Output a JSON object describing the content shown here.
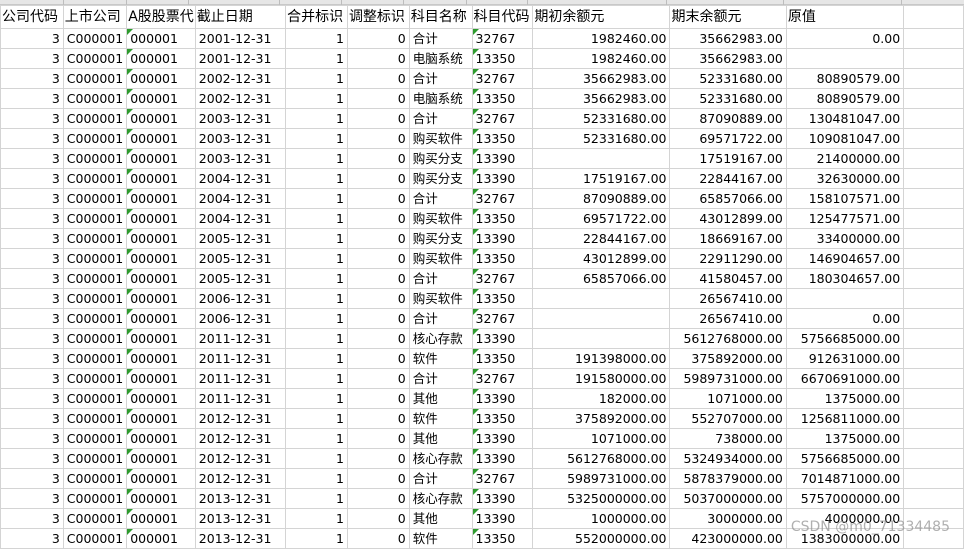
{
  "columns": [
    "公司代码",
    "上市公司",
    "A股股票代码",
    "截止日期",
    "合并标识",
    "调整标识",
    "科目名称",
    "科目代码",
    "期初余额元",
    "期末余额元",
    "原值"
  ],
  "header_visible": [
    "公司代码",
    "上市公司",
    "A股股票代",
    "截止日期",
    "合并标识",
    "调整标识",
    "科目名称",
    "科目代码",
    "期初余额元",
    "期末余额元",
    "原值"
  ],
  "rows": [
    [
      "3",
      "C000001",
      "000001",
      "2001-12-31",
      "1",
      "0",
      "合计",
      "32767",
      "1982460.00",
      "35662983.00",
      "0.00"
    ],
    [
      "3",
      "C000001",
      "000001",
      "2001-12-31",
      "1",
      "0",
      "电脑系统",
      "13350",
      "1982460.00",
      "35662983.00",
      ""
    ],
    [
      "3",
      "C000001",
      "000001",
      "2002-12-31",
      "1",
      "0",
      "合计",
      "32767",
      "35662983.00",
      "52331680.00",
      "80890579.00"
    ],
    [
      "3",
      "C000001",
      "000001",
      "2002-12-31",
      "1",
      "0",
      "电脑系统",
      "13350",
      "35662983.00",
      "52331680.00",
      "80890579.00"
    ],
    [
      "3",
      "C000001",
      "000001",
      "2003-12-31",
      "1",
      "0",
      "合计",
      "32767",
      "52331680.00",
      "87090889.00",
      "130481047.00"
    ],
    [
      "3",
      "C000001",
      "000001",
      "2003-12-31",
      "1",
      "0",
      "购买软件",
      "13350",
      "52331680.00",
      "69571722.00",
      "109081047.00"
    ],
    [
      "3",
      "C000001",
      "000001",
      "2003-12-31",
      "1",
      "0",
      "购买分支",
      "13390",
      "",
      "17519167.00",
      "21400000.00"
    ],
    [
      "3",
      "C000001",
      "000001",
      "2004-12-31",
      "1",
      "0",
      "购买分支",
      "13390",
      "17519167.00",
      "22844167.00",
      "32630000.00"
    ],
    [
      "3",
      "C000001",
      "000001",
      "2004-12-31",
      "1",
      "0",
      "合计",
      "32767",
      "87090889.00",
      "65857066.00",
      "158107571.00"
    ],
    [
      "3",
      "C000001",
      "000001",
      "2004-12-31",
      "1",
      "0",
      "购买软件",
      "13350",
      "69571722.00",
      "43012899.00",
      "125477571.00"
    ],
    [
      "3",
      "C000001",
      "000001",
      "2005-12-31",
      "1",
      "0",
      "购买分支",
      "13390",
      "22844167.00",
      "18669167.00",
      "33400000.00"
    ],
    [
      "3",
      "C000001",
      "000001",
      "2005-12-31",
      "1",
      "0",
      "购买软件",
      "13350",
      "43012899.00",
      "22911290.00",
      "146904657.00"
    ],
    [
      "3",
      "C000001",
      "000001",
      "2005-12-31",
      "1",
      "0",
      "合计",
      "32767",
      "65857066.00",
      "41580457.00",
      "180304657.00"
    ],
    [
      "3",
      "C000001",
      "000001",
      "2006-12-31",
      "1",
      "0",
      "购买软件",
      "13350",
      "",
      "26567410.00",
      ""
    ],
    [
      "3",
      "C000001",
      "000001",
      "2006-12-31",
      "1",
      "0",
      "合计",
      "32767",
      "",
      "26567410.00",
      "0.00"
    ],
    [
      "3",
      "C000001",
      "000001",
      "2011-12-31",
      "1",
      "0",
      "核心存款",
      "13390",
      "",
      "5612768000.00",
      "5756685000.00"
    ],
    [
      "3",
      "C000001",
      "000001",
      "2011-12-31",
      "1",
      "0",
      "软件",
      "13350",
      "191398000.00",
      "375892000.00",
      "912631000.00"
    ],
    [
      "3",
      "C000001",
      "000001",
      "2011-12-31",
      "1",
      "0",
      "合计",
      "32767",
      "191580000.00",
      "5989731000.00",
      "6670691000.00"
    ],
    [
      "3",
      "C000001",
      "000001",
      "2011-12-31",
      "1",
      "0",
      "其他",
      "13390",
      "182000.00",
      "1071000.00",
      "1375000.00"
    ],
    [
      "3",
      "C000001",
      "000001",
      "2012-12-31",
      "1",
      "0",
      "软件",
      "13350",
      "375892000.00",
      "552707000.00",
      "1256811000.00"
    ],
    [
      "3",
      "C000001",
      "000001",
      "2012-12-31",
      "1",
      "0",
      "其他",
      "13390",
      "1071000.00",
      "738000.00",
      "1375000.00"
    ],
    [
      "3",
      "C000001",
      "000001",
      "2012-12-31",
      "1",
      "0",
      "核心存款",
      "13390",
      "5612768000.00",
      "5324934000.00",
      "5756685000.00"
    ],
    [
      "3",
      "C000001",
      "000001",
      "2012-12-31",
      "1",
      "0",
      "合计",
      "32767",
      "5989731000.00",
      "5878379000.00",
      "7014871000.00"
    ],
    [
      "3",
      "C000001",
      "000001",
      "2013-12-31",
      "1",
      "0",
      "核心存款",
      "13390",
      "5325000000.00",
      "5037000000.00",
      "5757000000.00"
    ],
    [
      "3",
      "C000001",
      "000001",
      "2013-12-31",
      "1",
      "0",
      "其他",
      "13390",
      "1000000.00",
      "3000000.00",
      "4000000.00"
    ],
    [
      "3",
      "C000001",
      "000001",
      "2013-12-31",
      "1",
      "0",
      "软件",
      "13350",
      "552000000.00",
      "423000000.00",
      "1383000000.00"
    ]
  ],
  "watermark": "CSDN @m0_71334485",
  "colors": {
    "grid_line": "#d4d4d4",
    "text_flag": "#2e9b2e",
    "top_strip": "#e6e6e6"
  }
}
